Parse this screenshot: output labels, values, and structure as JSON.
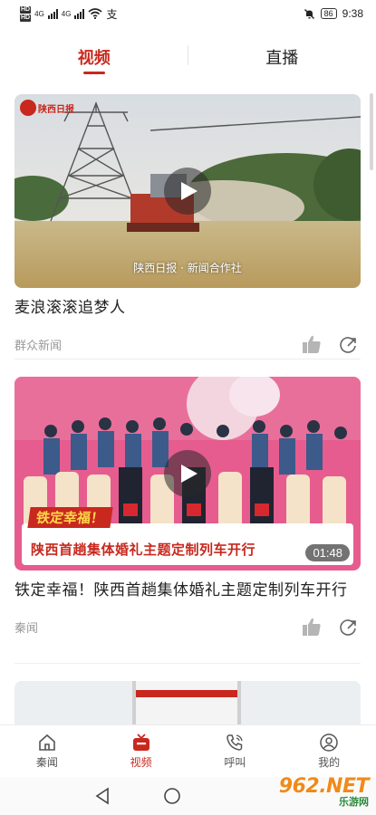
{
  "status_bar": {
    "sim1": "HD",
    "sim2": "HD",
    "net1": "4G",
    "net2": "4G",
    "extra_glyph": "支",
    "battery": "86",
    "time": "9:38"
  },
  "top_tabs": [
    {
      "label": "视频",
      "active": true
    },
    {
      "label": "直播",
      "active": false
    }
  ],
  "feed": [
    {
      "title": "麦浪滚滚追梦人",
      "source": "群众新闻",
      "caption": "陕西日报 · 新闻合作社",
      "duration": "",
      "logo_text": "陕西日报"
    },
    {
      "title": "铁定幸福！陕西首趟集体婚礼主题定制列车开行",
      "source": "秦闻",
      "duration": "01:48",
      "banner_top": "铁定幸福！",
      "banner_main": "陕西首趟集体婚礼主题定制列车开行"
    }
  ],
  "bottom_nav": [
    {
      "label": "秦闻",
      "icon": "home-icon",
      "active": false
    },
    {
      "label": "视频",
      "icon": "tv-icon",
      "active": true
    },
    {
      "label": "呼叫",
      "icon": "phone-icon",
      "active": false
    },
    {
      "label": "我的",
      "icon": "user-icon",
      "active": false
    }
  ],
  "watermark": {
    "brand": "962.NET",
    "sub": "乐游网"
  },
  "colors": {
    "accent": "#c8281e",
    "muted": "#9a9a9a"
  }
}
